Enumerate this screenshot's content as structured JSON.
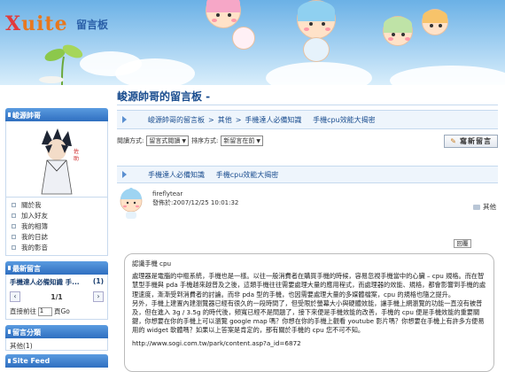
{
  "header": {
    "logo_x": "X",
    "logo_rest": "uite",
    "logo_sub": "留言板"
  },
  "page_title": "峻源帥哥的留言板 -",
  "sidebar": {
    "profile_title": "峻源帥哥",
    "links": [
      "關於我",
      "加入好友",
      "我的相簿",
      "我的日誌",
      "我的影音"
    ],
    "latest_title": "最新留言",
    "latest_item_text": "手機達人必備知識   手...",
    "latest_item_count": "(1)",
    "pager_count": "1/1",
    "goto_label": "直接前往",
    "goto_value": "1",
    "goto_suffix": "頁Go",
    "category_title": "留言分類",
    "category_item": "其他(1)",
    "feed_title": "Site Feed"
  },
  "breadcrumb": {
    "root": "峻源帥哥的留言板",
    "sep1": ">",
    "cat": "其他",
    "sep2": ">",
    "topic": "手機達人必備知識     手機cpu效能大揭密"
  },
  "toolbar": {
    "view_label": "閱讀方式:",
    "view_value": "留言式閱讀",
    "sort_label": "排序方式:",
    "sort_value": "新留言在前",
    "write_button": "寫新留言"
  },
  "section_title": "手機達人必備知識     手機cpu效能大揭密",
  "post": {
    "author": "fireflytear",
    "time": "發佈於:2007/12/25 10:01:32",
    "category": "其他",
    "reply_button": "回覆",
    "paragraphs": [
      "認識手機 cpu",
      "處理器是電腦的中樞系統，手機也是一樣。以往一般消費者在購買手機的時候，容易忽視手機當中的心臟 – cpu 規格。而在智慧型手機與 pda 手機越來越普及之後，這類手機往往需要處理大量的應用程式，而處理器的效能、規格，都會影響到手機的處理速度，漸漸受到消費者的討論。而非 pda 型的手機，也因需要處理大量的多媒體檔案，cpu 的規格也隨之提升。",
      "另外，手機上建置內建瀏覽器已經有很久的一段時間了，但受限於螢幕大小與硬體效能，讓手機上網瀏覽的功能一直沒有被普及，但在進入 3g / 3.5g 的時代後，頻寬已經不是問題了，接下來便是手機效能的改善，手機的 cpu 便是手機效能的重要關鍵，你想要在你的手機上可以瀏覽 google map 嗎？你想在你的手機上觀看 youtube 影片嗎？你想要在手機上有許多方便易用的 widget 軟體嗎？如果以上答案是肯定的，那有關於手機的 cpu 您不可不知。",
      "http://www.sogi.com.tw/park/content.asp?a_id=6872"
    ]
  },
  "colors": {
    "accent": "#1a4d8f",
    "sidebar_header": "#2f6fc0",
    "logo_red": "#e23b3b",
    "logo_orange": "#e8781e"
  }
}
